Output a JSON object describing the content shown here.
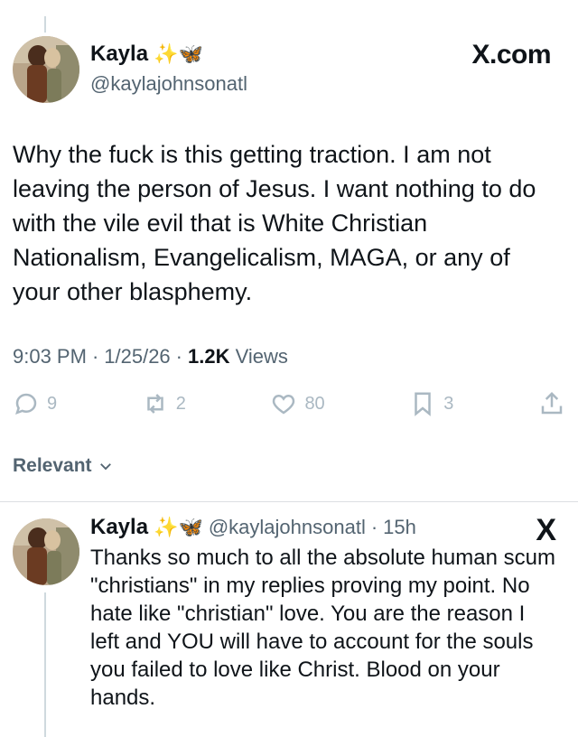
{
  "tweet": {
    "display_name": "Kayla",
    "emojis": "✨🦋",
    "handle": "@kaylajohnsonatl",
    "site_label": "X.com",
    "text": "Why the fuck is this getting traction. I am not leaving the person of Jesus. I want nothing to do with the vile evil that is White Christian Nationalism, Evangelicalism, MAGA, or any of your other blasphemy.",
    "time": "9:03 PM",
    "date": "1/25/26",
    "views_count": "1.2K",
    "views_label": "Views",
    "actions": {
      "replies": "9",
      "retweets": "2",
      "likes": "80",
      "bookmarks": "3"
    }
  },
  "sort_label": "Relevant",
  "reply": {
    "display_name": "Kayla",
    "emojis": "✨🦋",
    "handle": "@kaylajohnsonatl",
    "age": "15h",
    "x_logo": "X",
    "text": "Thanks so much to all the absolute human scum \"christians\" in my replies proving my point. No hate like \"christian\" love. You are the reason I left and YOU will have to account for the souls you failed to love like Christ. Blood on your hands."
  },
  "colors": {
    "text_primary": "#0f1419",
    "text_secondary": "#536471",
    "icon_muted": "#aab8c2"
  }
}
